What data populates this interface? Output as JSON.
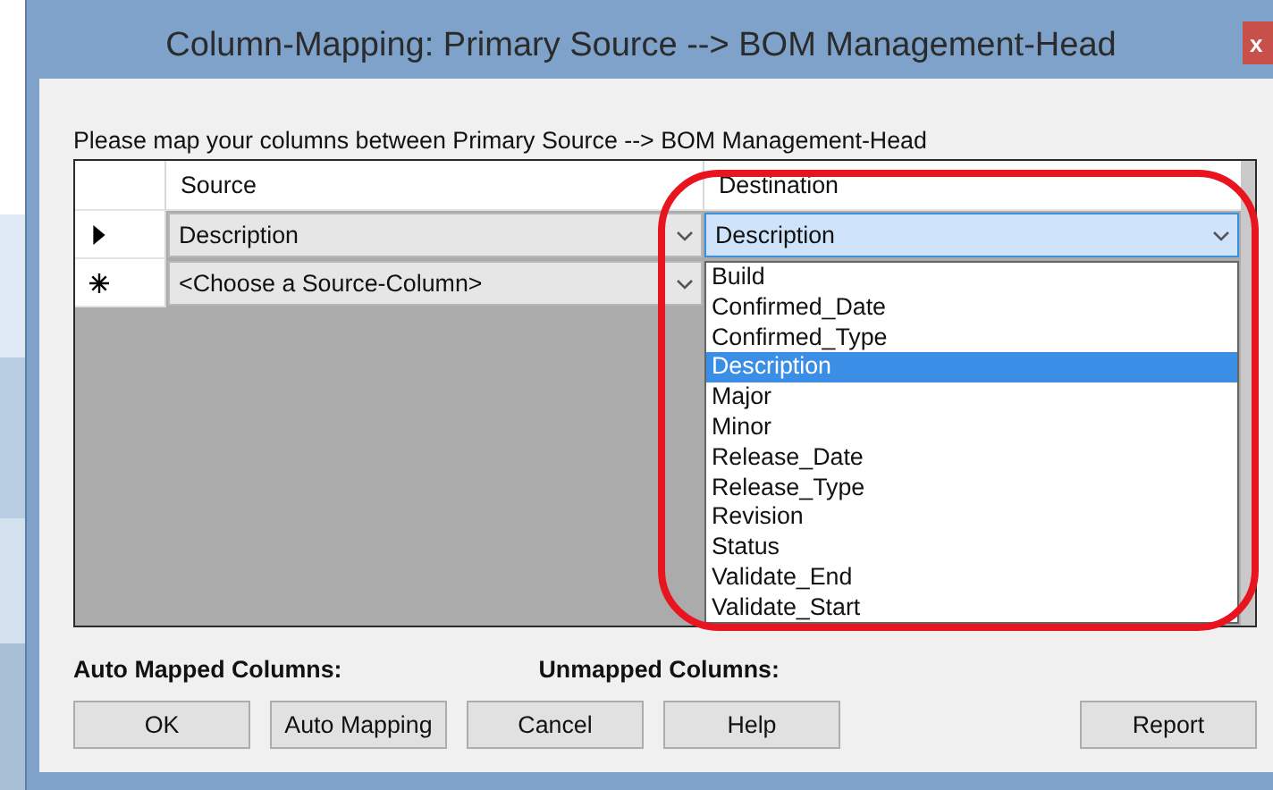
{
  "window": {
    "title": "Column-Mapping: Primary Source  -->  BOM Management-Head",
    "close": "x"
  },
  "instruction": "Please map your columns between Primary Source  -->  BOM Management-Head",
  "grid": {
    "columns": [
      "Source",
      "Destination"
    ],
    "rows": [
      {
        "kind": "current",
        "source": "Description",
        "destination": "Description",
        "selected": true
      },
      {
        "kind": "new",
        "source": "<Choose a Source-Column>"
      }
    ]
  },
  "dropdown": {
    "items": [
      {
        "label": "Build",
        "selected": false
      },
      {
        "label": "Confirmed_Date",
        "selected": false
      },
      {
        "label": "Confirmed_Type",
        "selected": false
      },
      {
        "label": "Description",
        "selected": true
      },
      {
        "label": "Major",
        "selected": false
      },
      {
        "label": "Minor",
        "selected": false
      },
      {
        "label": "Release_Date",
        "selected": false
      },
      {
        "label": "Release_Type",
        "selected": false
      },
      {
        "label": "Revision",
        "selected": false
      },
      {
        "label": "Status",
        "selected": false
      },
      {
        "label": "Validate_End",
        "selected": false
      },
      {
        "label": "Validate_Start",
        "selected": false
      }
    ]
  },
  "summary": [
    "Auto Mapped Columns:",
    "Unmapped Columns:"
  ],
  "buttons": [
    {
      "label": "OK",
      "kind": "left"
    },
    {
      "label": "Auto Mapping",
      "kind": "left"
    },
    {
      "label": "Cancel",
      "kind": "left"
    },
    {
      "label": "Help",
      "kind": "left"
    },
    {
      "label": "Report",
      "kind": "right"
    }
  ]
}
